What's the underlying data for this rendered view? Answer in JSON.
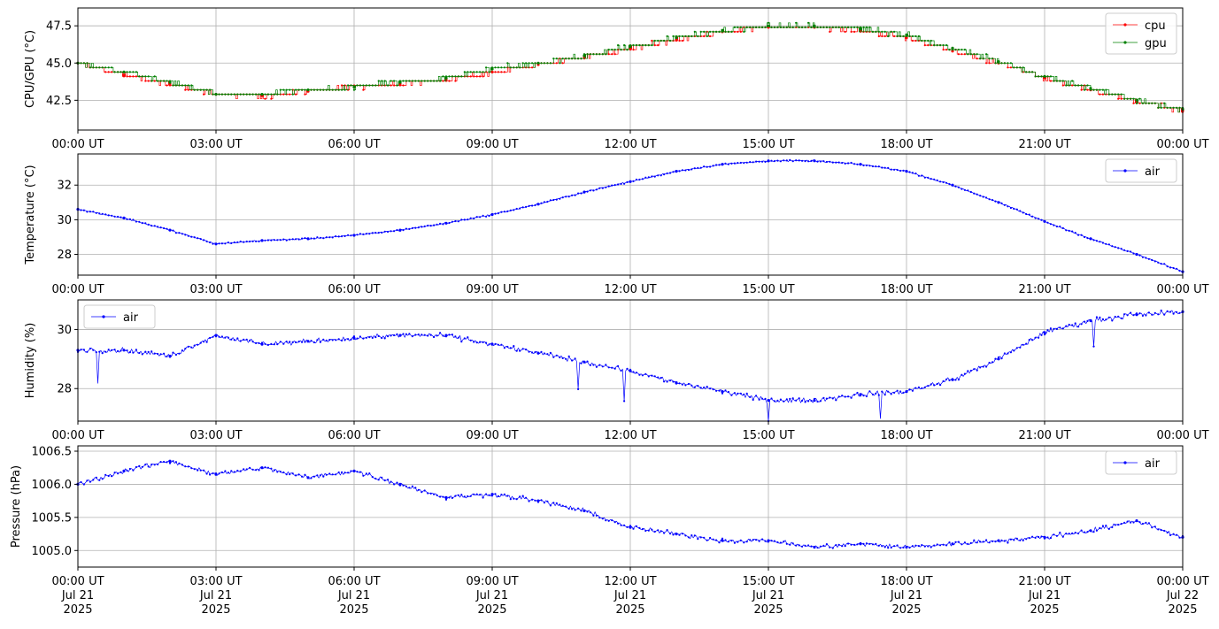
{
  "chart_data": [
    {
      "type": "line",
      "ylabel": "CPU/GPU (°C)",
      "xlim": [
        "2025-07-21 00:00",
        "2025-07-22 00:00"
      ],
      "ylim": [
        40.5,
        48.7
      ],
      "yticks": [
        "42.5",
        "45.0",
        "47.5"
      ],
      "xtick_labels": [
        "00:00 UT",
        "03:00 UT",
        "06:00 UT",
        "09:00 UT",
        "12:00 UT",
        "15:00 UT",
        "18:00 UT",
        "21:00 UT",
        "00:00 UT"
      ],
      "grid": true,
      "legend": "top-right",
      "x": [
        "00:00",
        "01:00",
        "02:00",
        "03:00",
        "04:00",
        "05:00",
        "06:00",
        "07:00",
        "08:00",
        "09:00",
        "10:00",
        "11:00",
        "12:00",
        "13:00",
        "14:00",
        "15:00",
        "16:00",
        "17:00",
        "18:00",
        "19:00",
        "20:00",
        "21:00",
        "22:00",
        "23:00",
        "24:00"
      ],
      "series": [
        {
          "name": "cpu",
          "color": "#ff0000",
          "values": [
            45.0,
            44.2,
            43.6,
            42.9,
            42.8,
            43.1,
            43.4,
            43.6,
            43.9,
            44.4,
            44.9,
            45.4,
            46.0,
            46.6,
            47.1,
            47.4,
            47.4,
            47.2,
            46.7,
            45.8,
            45.0,
            44.0,
            43.2,
            42.4,
            41.8
          ]
        },
        {
          "name": "gpu",
          "color": "#008000",
          "values": [
            45.0,
            44.4,
            43.7,
            42.9,
            42.9,
            43.2,
            43.4,
            43.7,
            44.0,
            44.6,
            45.0,
            45.5,
            46.1,
            46.7,
            47.2,
            47.5,
            47.5,
            47.3,
            46.9,
            46.0,
            45.1,
            44.1,
            43.3,
            42.5,
            41.9
          ]
        }
      ]
    },
    {
      "type": "line",
      "ylabel": "Temperature (°C)",
      "xlim": [
        "2025-07-21 00:00",
        "2025-07-22 00:00"
      ],
      "ylim": [
        26.8,
        33.8
      ],
      "yticks": [
        "28",
        "30",
        "32"
      ],
      "xtick_labels": [
        "00:00 UT",
        "03:00 UT",
        "06:00 UT",
        "09:00 UT",
        "12:00 UT",
        "15:00 UT",
        "18:00 UT",
        "21:00 UT",
        "00:00 UT"
      ],
      "grid": true,
      "legend": "top-right",
      "x": [
        "00:00",
        "01:00",
        "02:00",
        "03:00",
        "04:00",
        "05:00",
        "06:00",
        "07:00",
        "08:00",
        "09:00",
        "10:00",
        "11:00",
        "12:00",
        "13:00",
        "14:00",
        "15:00",
        "16:00",
        "17:00",
        "18:00",
        "19:00",
        "20:00",
        "21:00",
        "22:00",
        "23:00",
        "24:00"
      ],
      "series": [
        {
          "name": "air",
          "color": "#0000ff",
          "values": [
            30.6,
            30.1,
            29.4,
            28.6,
            28.8,
            28.9,
            29.1,
            29.4,
            29.8,
            30.3,
            30.9,
            31.6,
            32.2,
            32.8,
            33.2,
            33.4,
            33.4,
            33.2,
            32.8,
            32.0,
            31.0,
            29.9,
            28.9,
            28.0,
            27.0
          ]
        }
      ]
    },
    {
      "type": "line",
      "ylabel": "Humidity (%)",
      "xlim": [
        "2025-07-21 00:00",
        "2025-07-22 00:00"
      ],
      "ylim": [
        26.9,
        31.0
      ],
      "yticks": [
        "28",
        "30"
      ],
      "xtick_labels": [
        "00:00 UT",
        "03:00 UT",
        "06:00 UT",
        "09:00 UT",
        "12:00 UT",
        "15:00 UT",
        "18:00 UT",
        "21:00 UT",
        "00:00 UT"
      ],
      "grid": true,
      "legend": "top-left",
      "x": [
        "00:00",
        "01:00",
        "02:00",
        "03:00",
        "04:00",
        "05:00",
        "06:00",
        "07:00",
        "08:00",
        "09:00",
        "10:00",
        "11:00",
        "12:00",
        "13:00",
        "14:00",
        "15:00",
        "16:00",
        "17:00",
        "18:00",
        "19:00",
        "20:00",
        "21:00",
        "22:00",
        "23:00",
        "24:00"
      ],
      "series": [
        {
          "name": "air",
          "color": "#0000ff",
          "values": [
            29.3,
            29.3,
            29.1,
            29.8,
            29.5,
            29.6,
            29.7,
            29.8,
            29.8,
            29.5,
            29.2,
            28.9,
            28.6,
            28.2,
            27.9,
            27.6,
            27.6,
            27.8,
            27.9,
            28.3,
            29.0,
            29.9,
            30.3,
            30.5,
            30.6
          ]
        }
      ]
    },
    {
      "type": "line",
      "ylabel": "Pressure (hPa)",
      "xlim": [
        "2025-07-21 00:00",
        "2025-07-22 00:00"
      ],
      "ylim": [
        1004.75,
        1006.58
      ],
      "yticks": [
        "1005.0",
        "1005.5",
        "1006.0",
        "1006.5"
      ],
      "xtick_labels": [
        "00:00 UT\nJul 21\n2025",
        "03:00 UT\nJul 21\n2025",
        "06:00 UT\nJul 21\n2025",
        "09:00 UT\nJul 21\n2025",
        "12:00 UT\nJul 21\n2025",
        "15:00 UT\nJul 21\n2025",
        "18:00 UT\nJul 21\n2025",
        "21:00 UT\nJul 21\n2025",
        "00:00 UT\nJul 22\n2025"
      ],
      "grid": true,
      "legend": "top-right",
      "x": [
        "00:00",
        "01:00",
        "02:00",
        "03:00",
        "04:00",
        "05:00",
        "06:00",
        "07:00",
        "08:00",
        "09:00",
        "10:00",
        "11:00",
        "12:00",
        "13:00",
        "14:00",
        "15:00",
        "16:00",
        "17:00",
        "18:00",
        "19:00",
        "20:00",
        "21:00",
        "22:00",
        "23:00",
        "24:00"
      ],
      "series": [
        {
          "name": "air",
          "color": "#0000ff",
          "values": [
            1006.0,
            1006.2,
            1006.35,
            1006.15,
            1006.25,
            1006.1,
            1006.2,
            1006.0,
            1005.8,
            1005.85,
            1005.75,
            1005.6,
            1005.35,
            1005.25,
            1005.15,
            1005.15,
            1005.05,
            1005.1,
            1005.05,
            1005.1,
            1005.15,
            1005.2,
            1005.3,
            1005.45,
            1005.2
          ]
        }
      ]
    }
  ]
}
